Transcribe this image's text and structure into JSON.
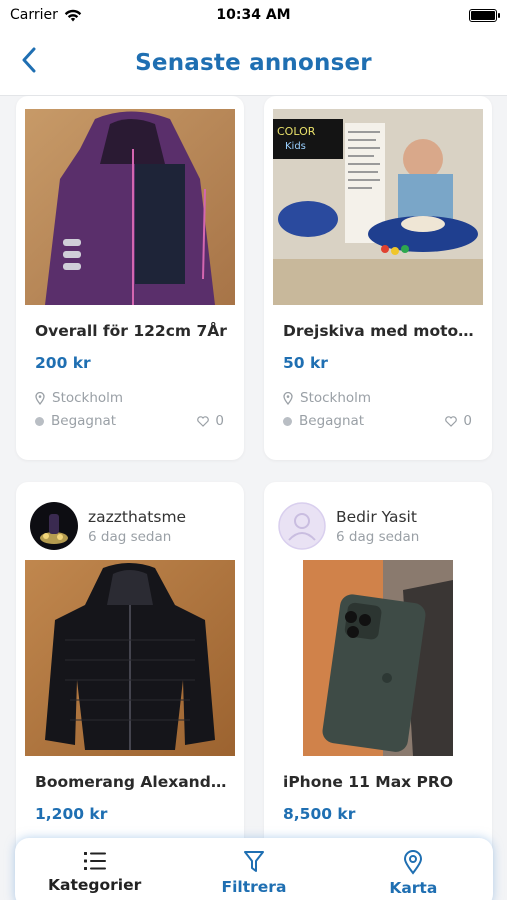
{
  "status": {
    "carrier": "Carrier",
    "time": "10:34 AM"
  },
  "header": {
    "title": "Senaste annonser",
    "back_icon": "chevron-left-icon"
  },
  "listings": [
    {
      "name": "Overall för 122cm 7År",
      "price": "200 kr",
      "location": "Stockholm",
      "condition": "Begagnat",
      "likes": "0"
    },
    {
      "name": "Drejskiva med motor ...",
      "price": "50 kr",
      "location": "Stockholm",
      "condition": "Begagnat",
      "likes": "0"
    },
    {
      "seller": "zazzthatsme",
      "posted": "6 dag sedan",
      "name": "Boomerang Alexandr...",
      "price": "1,200 kr"
    },
    {
      "seller": "Bedir Yasit",
      "posted": "6 dag sedan",
      "name": "iPhone 11 Max PRO",
      "price": "8,500 kr"
    }
  ],
  "bottom_nav": [
    {
      "label": "Kategorier",
      "icon": "list-icon"
    },
    {
      "label": "Filtrera",
      "icon": "filter-icon"
    },
    {
      "label": "Karta",
      "icon": "map-pin-icon"
    }
  ],
  "colors": {
    "accent": "#1f6fb2",
    "muted": "#9aa0a6",
    "background": "#f3f4f6"
  }
}
